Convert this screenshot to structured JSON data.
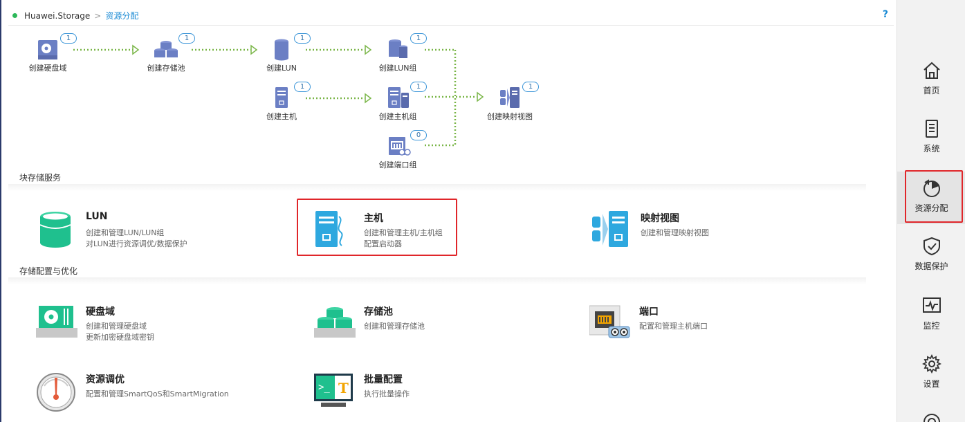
{
  "breadcrumb": {
    "root": "Huawei.Storage",
    "separator": ">",
    "current": "资源分配",
    "help": "?"
  },
  "flow": {
    "disk_domain": {
      "label": "创建硬盘域",
      "count": "1"
    },
    "storage_pool": {
      "label": "创建存储池",
      "count": "1"
    },
    "lun": {
      "label": "创建LUN",
      "count": "1"
    },
    "lun_group": {
      "label": "创建LUN组",
      "count": "1"
    },
    "host": {
      "label": "创建主机",
      "count": "1"
    },
    "host_group": {
      "label": "创建主机组",
      "count": "1"
    },
    "port_group": {
      "label": "创建端口组",
      "count": "0"
    },
    "mapping_view": {
      "label": "创建映射视图",
      "count": "1"
    }
  },
  "sections": {
    "block": "块存储服务",
    "config": "存储配置与优化"
  },
  "cards": {
    "lun": {
      "title": "LUN",
      "desc1": "创建和管理LUN/LUN组",
      "desc2": "对LUN进行资源调优/数据保护"
    },
    "host": {
      "title": "主机",
      "desc1": "创建和管理主机/主机组",
      "desc2": "配置启动器"
    },
    "mapping": {
      "title": "映射视图",
      "desc1": "创建和管理映射视图",
      "desc2": ""
    },
    "disk_domain": {
      "title": "硬盘域",
      "desc1": "创建和管理硬盘域",
      "desc2": "更新加密硬盘域密钥"
    },
    "pool": {
      "title": "存储池",
      "desc1": "创建和管理存储池",
      "desc2": ""
    },
    "port": {
      "title": "端口",
      "desc1": "配置和管理主机端口",
      "desc2": ""
    },
    "tuning": {
      "title": "资源调优",
      "desc1": "配置和管理SmartQoS和SmartMigration",
      "desc2": ""
    },
    "batch": {
      "title": "批量配置",
      "desc1": "执行批量操作",
      "desc2": ""
    }
  },
  "nav": {
    "home": "首页",
    "system": "系统",
    "provisioning": "资源分配",
    "protection": "数据保护",
    "monitor": "监控",
    "settings": "设置"
  },
  "colors": {
    "accent": "#1a8ad4",
    "highlight": "#e0262a",
    "flow_arrow": "#7ab648",
    "teal": "#1fc08e",
    "blue": "#2ea8df"
  }
}
